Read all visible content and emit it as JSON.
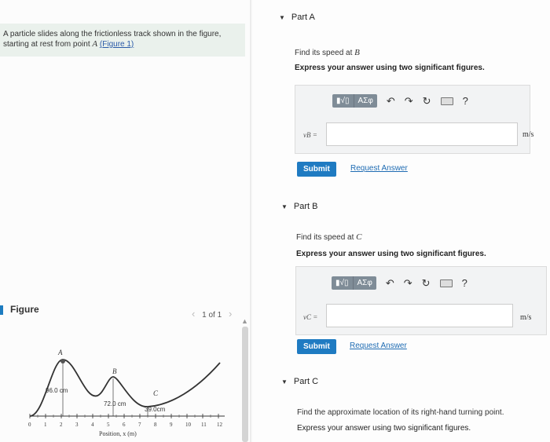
{
  "problem": {
    "text_line1": "A particle slides along the frictionless track shown in the figure,",
    "text_line2": "starting at rest from point ",
    "point": "A",
    "figure_link": "(Figure 1)"
  },
  "figure_panel": {
    "label": "Figure",
    "nav": "1 of 1",
    "labels": {
      "A": "A",
      "B": "B",
      "C": "C",
      "h1": "96.0 cm",
      "h2": "72.0 cm",
      "h3": "39.0cm",
      "xaxis": "Position, x (m)",
      "ticks": [
        "0",
        "1",
        "2",
        "3",
        "4",
        "5",
        "6",
        "7",
        "8",
        "9",
        "10",
        "11",
        "12"
      ]
    }
  },
  "parts": [
    {
      "title": "Part A",
      "question": "Find its speed at ",
      "point": "B",
      "instruction": "Express your answer using two significant figures.",
      "var": "vB =",
      "unit": "m/s",
      "submit": "Submit",
      "request": "Request Answer"
    },
    {
      "title": "Part B",
      "question": "Find its speed at ",
      "point": "C",
      "instruction": "Express your answer using two significant figures.",
      "var": "vC =",
      "unit": "m/s",
      "submit": "Submit",
      "request": "Request Answer"
    },
    {
      "title": "Part C",
      "question": "Find the approximate location of its right-hand turning point.",
      "instruction": "Express your answer using two significant figures."
    }
  ],
  "toolbar": {
    "template_label": "▮√▯",
    "greek_label": "ΑΣφ",
    "help": "?"
  }
}
